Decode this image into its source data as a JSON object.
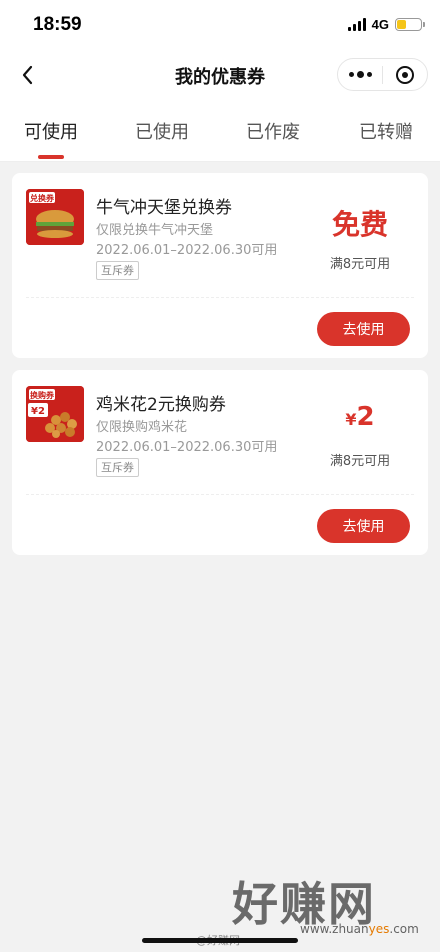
{
  "status_bar": {
    "time": "18:59",
    "network": "4G",
    "battery_level": 0.4,
    "icons": [
      "signal-icon",
      "battery-icon"
    ]
  },
  "nav": {
    "title": "我的优惠券",
    "back_icon": "chevron-left-icon",
    "more_icon": "more-dots-icon",
    "close_icon": "target-close-icon"
  },
  "tabs": [
    {
      "label": "可使用",
      "active": true
    },
    {
      "label": "已使用",
      "active": false
    },
    {
      "label": "已作废",
      "active": false
    },
    {
      "label": "已转赠",
      "active": false
    }
  ],
  "coupons": [
    {
      "badge": "兑换券",
      "name": "牛气冲天堡兑换券",
      "scope": "仅限兑换牛气冲天堡",
      "date": "2022.06.01–2022.06.30可用",
      "tag": "互斥券",
      "value": "免费",
      "threshold": "满8元可用",
      "button": "去使用"
    },
    {
      "badge": "换购券",
      "badge_price": "¥2",
      "name": "鸡米花2元换购券",
      "scope": "仅限换购鸡米花",
      "date": "2022.06.01–2022.06.30可用",
      "tag": "互斥券",
      "value_currency": "¥",
      "value_amount": "2",
      "threshold": "满8元可用",
      "button": "去使用"
    }
  ],
  "watermark": {
    "big": "好赚网",
    "url_prefix": "www.zhuan",
    "url_highlight": "yes",
    "url_suffix": ".com",
    "weibo": "@好赚网"
  },
  "colors": {
    "accent": "#d9342b",
    "background": "#f2f2f2"
  }
}
